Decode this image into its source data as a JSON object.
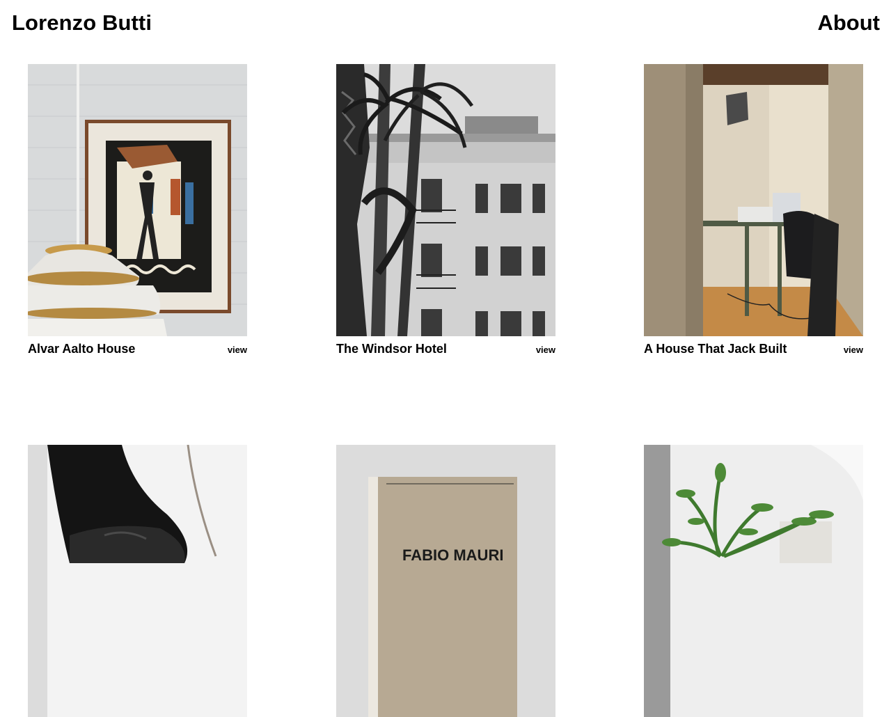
{
  "header": {
    "title": "Lorenzo Butti",
    "about_label": "About"
  },
  "projects": [
    {
      "title": "Alvar Aalto House",
      "view_label": "view"
    },
    {
      "title": "The Windsor Hotel",
      "view_label": "view"
    },
    {
      "title": "A House That Jack Built",
      "view_label": "view"
    },
    {
      "title": "",
      "view_label": ""
    },
    {
      "title": "",
      "view_label": "",
      "book_text": "FABIO MAURI"
    },
    {
      "title": "",
      "view_label": ""
    }
  ]
}
